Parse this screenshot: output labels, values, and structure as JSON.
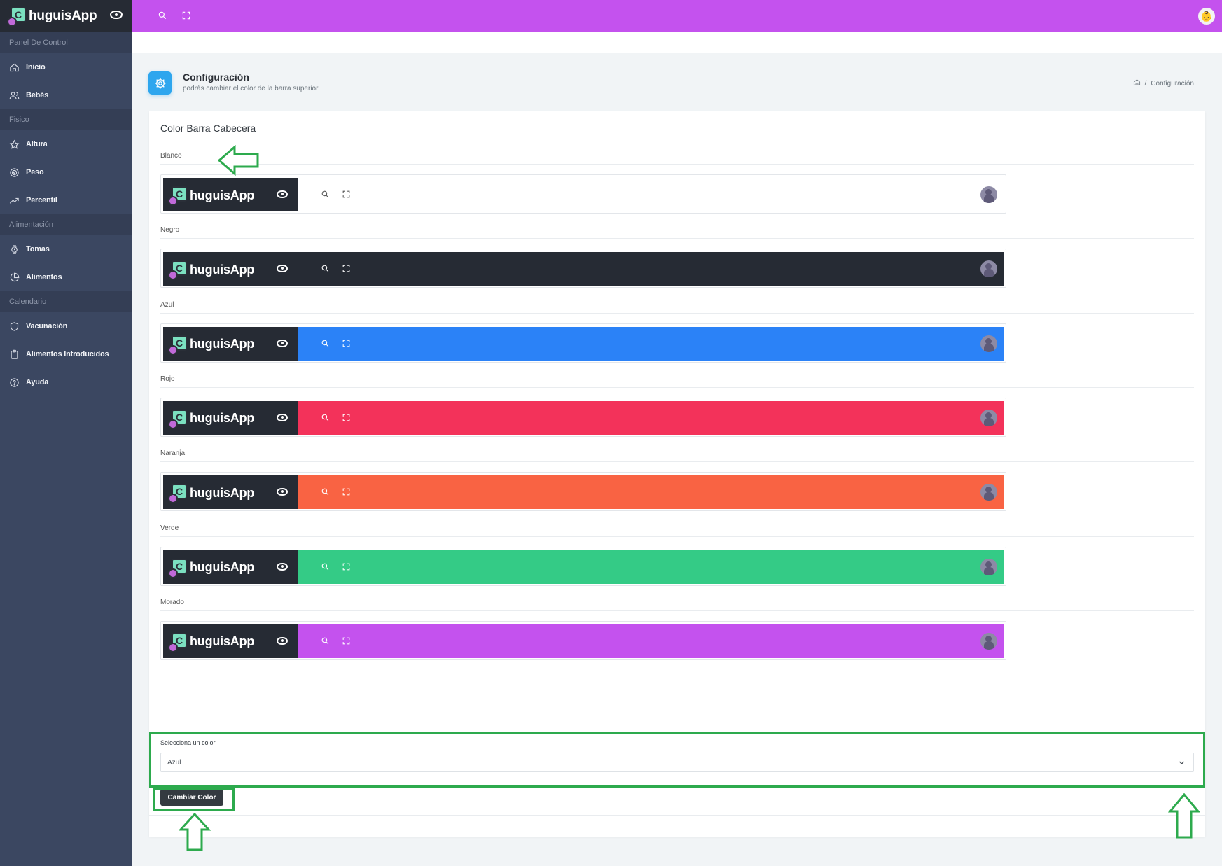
{
  "app": {
    "name": "huguisApp",
    "logo_letter": "C"
  },
  "sidebar": {
    "sections": [
      {
        "title": "Panel De Control",
        "items": [
          {
            "label": "Inicio",
            "icon": "home-icon"
          },
          {
            "label": "Bebés",
            "icon": "users-icon"
          }
        ]
      },
      {
        "title": "Fisico",
        "items": [
          {
            "label": "Altura",
            "icon": "star-icon"
          },
          {
            "label": "Peso",
            "icon": "target-icon"
          },
          {
            "label": "Percentil",
            "icon": "trending-up-icon"
          }
        ]
      },
      {
        "title": "Alimentación",
        "items": [
          {
            "label": "Tomas",
            "icon": "watch-icon"
          },
          {
            "label": "Alimentos",
            "icon": "pie-chart-icon"
          }
        ]
      },
      {
        "title": "Calendario",
        "items": [
          {
            "label": "Vacunación",
            "icon": "shield-icon"
          },
          {
            "label": "Alimentos Introducidos",
            "icon": "clipboard-icon"
          },
          {
            "label": "Ayuda",
            "icon": "help-circle-icon"
          }
        ]
      }
    ]
  },
  "topbar": {
    "color": "#c452ee",
    "icons": [
      "search-icon",
      "fullscreen-icon"
    ],
    "avatar_glyph": "👶"
  },
  "page": {
    "title": "Configuración",
    "subtitle": "podrás cambiar el color de la barra superior",
    "breadcrumb": "Configuración"
  },
  "card": {
    "title": "Color Barra Cabecera",
    "options": [
      {
        "label": "Blanco",
        "color": "#ffffff",
        "icon_color": "#555555"
      },
      {
        "label": "Negro",
        "color": "#262b34",
        "icon_color": "#ffffff"
      },
      {
        "label": "Azul",
        "color": "#2b82f7",
        "icon_color": "#ffffff"
      },
      {
        "label": "Rojo",
        "color": "#f3325a",
        "icon_color": "#ffffff"
      },
      {
        "label": "Naranja",
        "color": "#f96343",
        "icon_color": "#ffffff"
      },
      {
        "label": "Verde",
        "color": "#34cb86",
        "icon_color": "#ffffff"
      },
      {
        "label": "Morado",
        "color": "#c452ee",
        "icon_color": "#ffffff"
      }
    ],
    "select_label": "Selecciona un color",
    "select_value": "Azul",
    "button_label": "Cambiar Color"
  }
}
